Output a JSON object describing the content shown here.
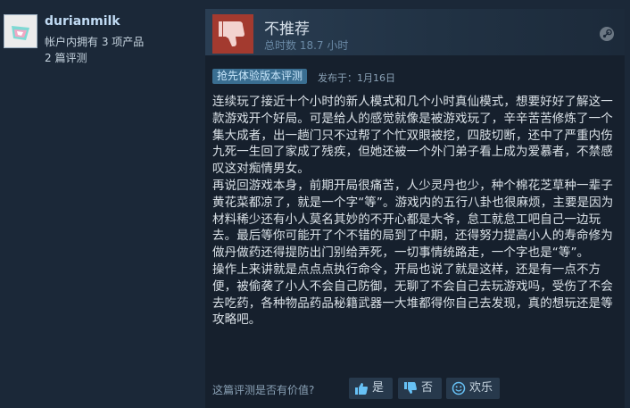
{
  "user": {
    "username": "durianmilk",
    "products_owned": "帐户内拥有 3 项产品",
    "review_count": "2 篇评测"
  },
  "review": {
    "verdict": "不推荐",
    "hours": "总时数 18.7 小时",
    "badge": "抢先体验版本评测",
    "posted": "发布于：1月16日",
    "paragraphs": [
      "连续玩了接近十个小时的新人模式和几个小时真仙模式，想要好好了解这一款游戏开个好局。可是给人的感觉就像是被游戏玩了，辛辛苦苦修炼了一个集大成者，出一趟门只不过帮了个忙双眼被挖，四肢切断，还中了严重内伤九死一生回了家成了残疾，但她还被一个外门弟子看上成为爱慕者，不禁感叹这对痴情男女。",
      "再说回游戏本身，前期开局很痛苦，人少灵丹也少，种个棉花芝草种一辈子黄花菜都凉了，就是一个字“等”。游戏内的五行八卦也很麻烦，主要是因为材料稀少还有小人莫名其妙的不开心都是大爷，怠工就怠工吧自己一边玩去。最后等你可能开了个不错的局到了中期，还得努力提高小人的寿命修为做丹做药还得提防出门别给弄死，一切事情统路走，一个字也是“等”。",
      "操作上来讲就是点点点执行命令，开局也说了就是这样，还是有一点不方便，被偷袭了小人不会自己防御，无聊了不会自己去玩游戏吗，受伤了不会去吃药，各种物品药品秘籍武器一大堆都得你自己去发现，真的想玩还是等攻略吧。"
    ]
  },
  "feedback": {
    "question": "这篇评测是否有价值?",
    "yes_label": "是",
    "no_label": "否",
    "funny_label": "欢乐"
  },
  "colors": {
    "background": "#1b2838",
    "thumb_down_red": "#a33a2f",
    "badge_blue": "#3a6e91",
    "username": "#c1dbf4"
  }
}
